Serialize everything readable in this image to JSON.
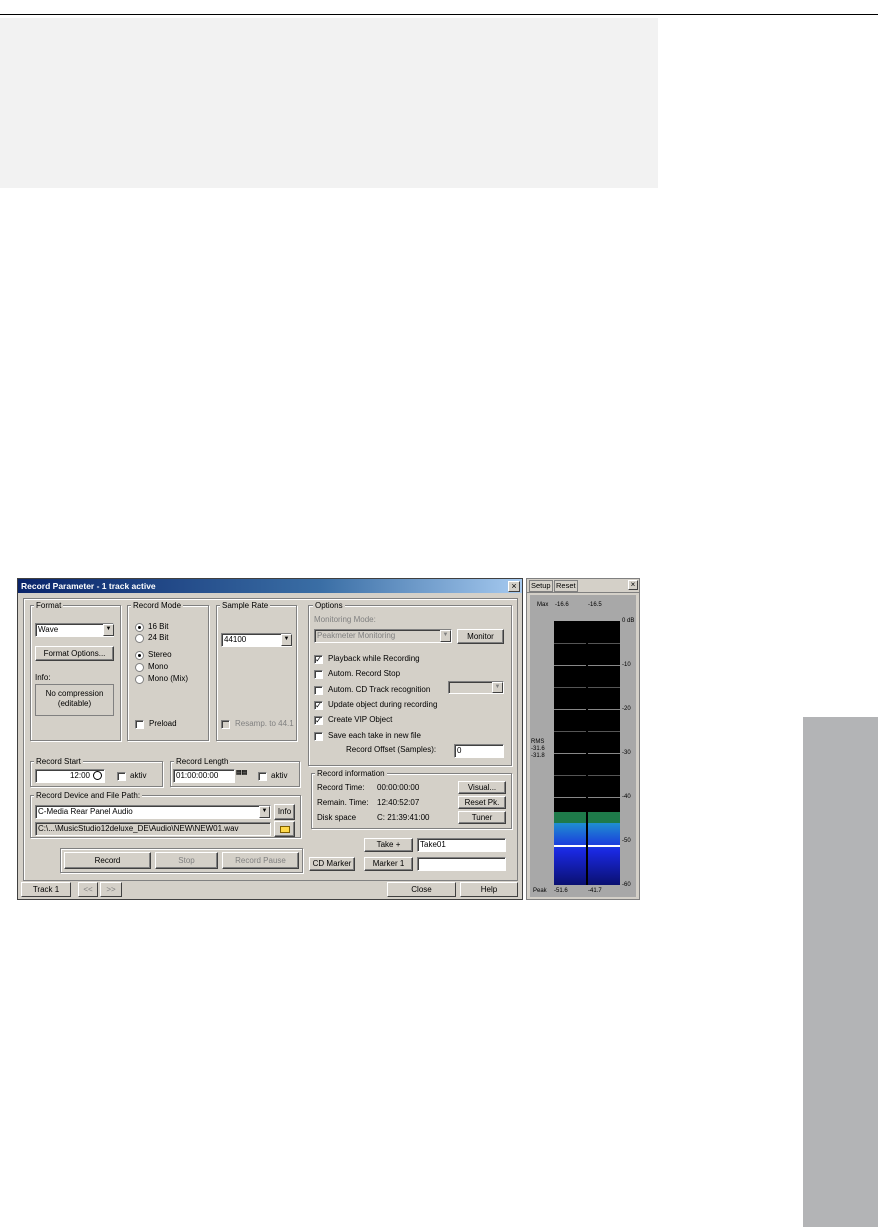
{
  "window": {
    "title": "Record Parameter - 1 track active",
    "close_glyph": "×"
  },
  "format": {
    "label": "Format",
    "selected": "Wave",
    "options_button": "Format Options...",
    "info_label": "Info:",
    "info_line1": "No compression",
    "info_line2": "(editable)"
  },
  "record_mode": {
    "label": "Record Mode",
    "bits": [
      "16 Bit",
      "24 Bit"
    ],
    "bits_selected": 0,
    "channels": [
      "Stereo",
      "Mono",
      "Mono (Mix)"
    ],
    "channels_selected": 0,
    "preload": "Preload"
  },
  "sample_rate": {
    "label": "Sample Rate",
    "selected": "44100",
    "resample": "Resamp. to 44.1"
  },
  "options": {
    "label": "Options",
    "monitoring_label": "Monitoring Mode:",
    "monitoring_selected": "Peakmeter Monitoring",
    "monitor_button": "Monitor",
    "checks": [
      {
        "label": "Playback while Recording",
        "checked": true
      },
      {
        "label": "Autom. Record Stop",
        "checked": false
      },
      {
        "label": "Autom. CD Track recognition",
        "checked": false
      },
      {
        "label": "Update object during recording",
        "checked": true
      },
      {
        "label": "Create VIP Object",
        "checked": true
      },
      {
        "label": "Save each take in new file",
        "checked": false
      }
    ],
    "offset_label": "Record Offset (Samples):",
    "offset_value": "0"
  },
  "record_start": {
    "label": "Record Start",
    "value": "12:00",
    "aktiv": "aktiv"
  },
  "record_length": {
    "label": "Record Length",
    "value": "01:00:00:00",
    "aktiv": "aktiv"
  },
  "device": {
    "label": "Record Device and File Path:",
    "selected": "C-Media Rear Panel Audio",
    "info_button": "Info",
    "path": "C:\\...\\MusicStudio12deluxe_DE\\Audio\\NEW\\NEW01.wav"
  },
  "record_info": {
    "label": "Record information",
    "rows": [
      {
        "key": "Record Time:",
        "value": "00:00:00:00"
      },
      {
        "key": "Remain. Time:",
        "value": "12:40:52:07"
      },
      {
        "key": "Disk space",
        "value": "C: 21:39:41:00"
      }
    ],
    "visual_button": "Visual...",
    "reset_button": "Reset Pk.",
    "tuner_button": "Tuner"
  },
  "takes": {
    "take_button": "Take +",
    "take_value": "Take01",
    "cd_marker_button": "CD Marker",
    "marker_button": "Marker 1",
    "marker_value": ""
  },
  "transport": {
    "record": "Record",
    "stop": "Stop",
    "pause": "Record Pause"
  },
  "status": {
    "track": "Track 1",
    "prev": "<<",
    "next": ">>",
    "close": "Close",
    "help": "Help"
  },
  "meter": {
    "setup": "Setup",
    "reset": "Reset",
    "close_glyph": "×",
    "max_label": "Max",
    "max_left": "-16.6",
    "max_right": "-16.5",
    "scale": [
      "0 dB",
      "-10",
      "-20",
      "-30",
      "-40",
      "-50",
      "-60"
    ],
    "rms_label": "RMS",
    "rms_left": "-31.6",
    "rms_right": "-31.8",
    "peak_label": "Peak",
    "peak_left": "-51.6",
    "peak_right": "-41.7",
    "colors": {
      "green": "#1e7a4a",
      "blue": "#1a28e0",
      "black": "#000000"
    }
  }
}
